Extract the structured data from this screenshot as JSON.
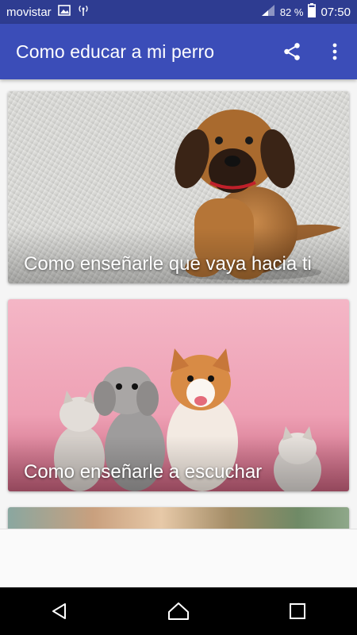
{
  "status_bar": {
    "carrier": "movistar",
    "battery_text": "82 %",
    "time": "07:50"
  },
  "app_bar": {
    "title": "Como educar a mi perro"
  },
  "cards": [
    {
      "caption": "Como enseñarle que vaya hacia ti"
    },
    {
      "caption": "Como enseñarle a escuchar"
    },
    {
      "caption": ""
    }
  ],
  "colors": {
    "status_bar": "#2e3c91",
    "app_bar": "#3b4db8",
    "nav_bar": "#000000"
  },
  "icons": {
    "share": "share-icon",
    "more": "more-vert-icon",
    "back": "back-icon",
    "home": "home-icon",
    "recents": "recents-icon"
  }
}
